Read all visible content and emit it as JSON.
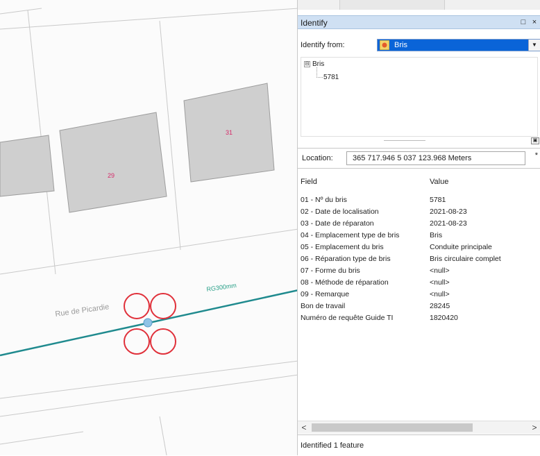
{
  "map": {
    "buildings": [
      {
        "label": ""
      },
      {
        "label": "29"
      },
      {
        "label": "31"
      }
    ],
    "street_label": "Rue de Picardie",
    "pipe_label": "RG300mm"
  },
  "identify": {
    "window_title": "Identify",
    "restore_icon": "□",
    "close_icon": "×",
    "identify_from_label": "Identify from:",
    "identify_from_value": "Bris",
    "tree": {
      "layer": "Bris",
      "feature": "5781",
      "expander": "⊟"
    },
    "location_label": "Location:",
    "location_value": "365 717.946  5 037 123.968 Meters",
    "location_more": "*",
    "columns": {
      "field": "Field",
      "value": "Value"
    },
    "rows": [
      {
        "field": "01 - Nº du bris",
        "value": "5781"
      },
      {
        "field": "02 - Date de localisation",
        "value": "2021-08-23"
      },
      {
        "field": "03 - Date de réparaton",
        "value": "2021-08-23"
      },
      {
        "field": "04 - Emplacement type de bris",
        "value": "Bris"
      },
      {
        "field": "05 - Emplacement du bris",
        "value": "Conduite principale"
      },
      {
        "field": "06 - Réparation type de bris",
        "value": "Bris circulaire complet"
      },
      {
        "field": "07 - Forme du bris",
        "value": "<null>"
      },
      {
        "field": "08 - Méthode de réparation",
        "value": "<null>"
      },
      {
        "field": "09 - Remarque",
        "value": "<null>"
      },
      {
        "field": "Bon de travail",
        "value": "28245"
      },
      {
        "field": "Numéro de requête Guide TI",
        "value": "1820420"
      }
    ],
    "scroll_left": "<",
    "scroll_right": ">",
    "status": "Identified 1 feature"
  },
  "colors": {
    "title_bar": "#cfe0f3",
    "selection": "#0a64d8",
    "pipe": "#1f8a8e",
    "highlight_cloud": "#e0303a",
    "building_fill": "#cfcfcf"
  }
}
